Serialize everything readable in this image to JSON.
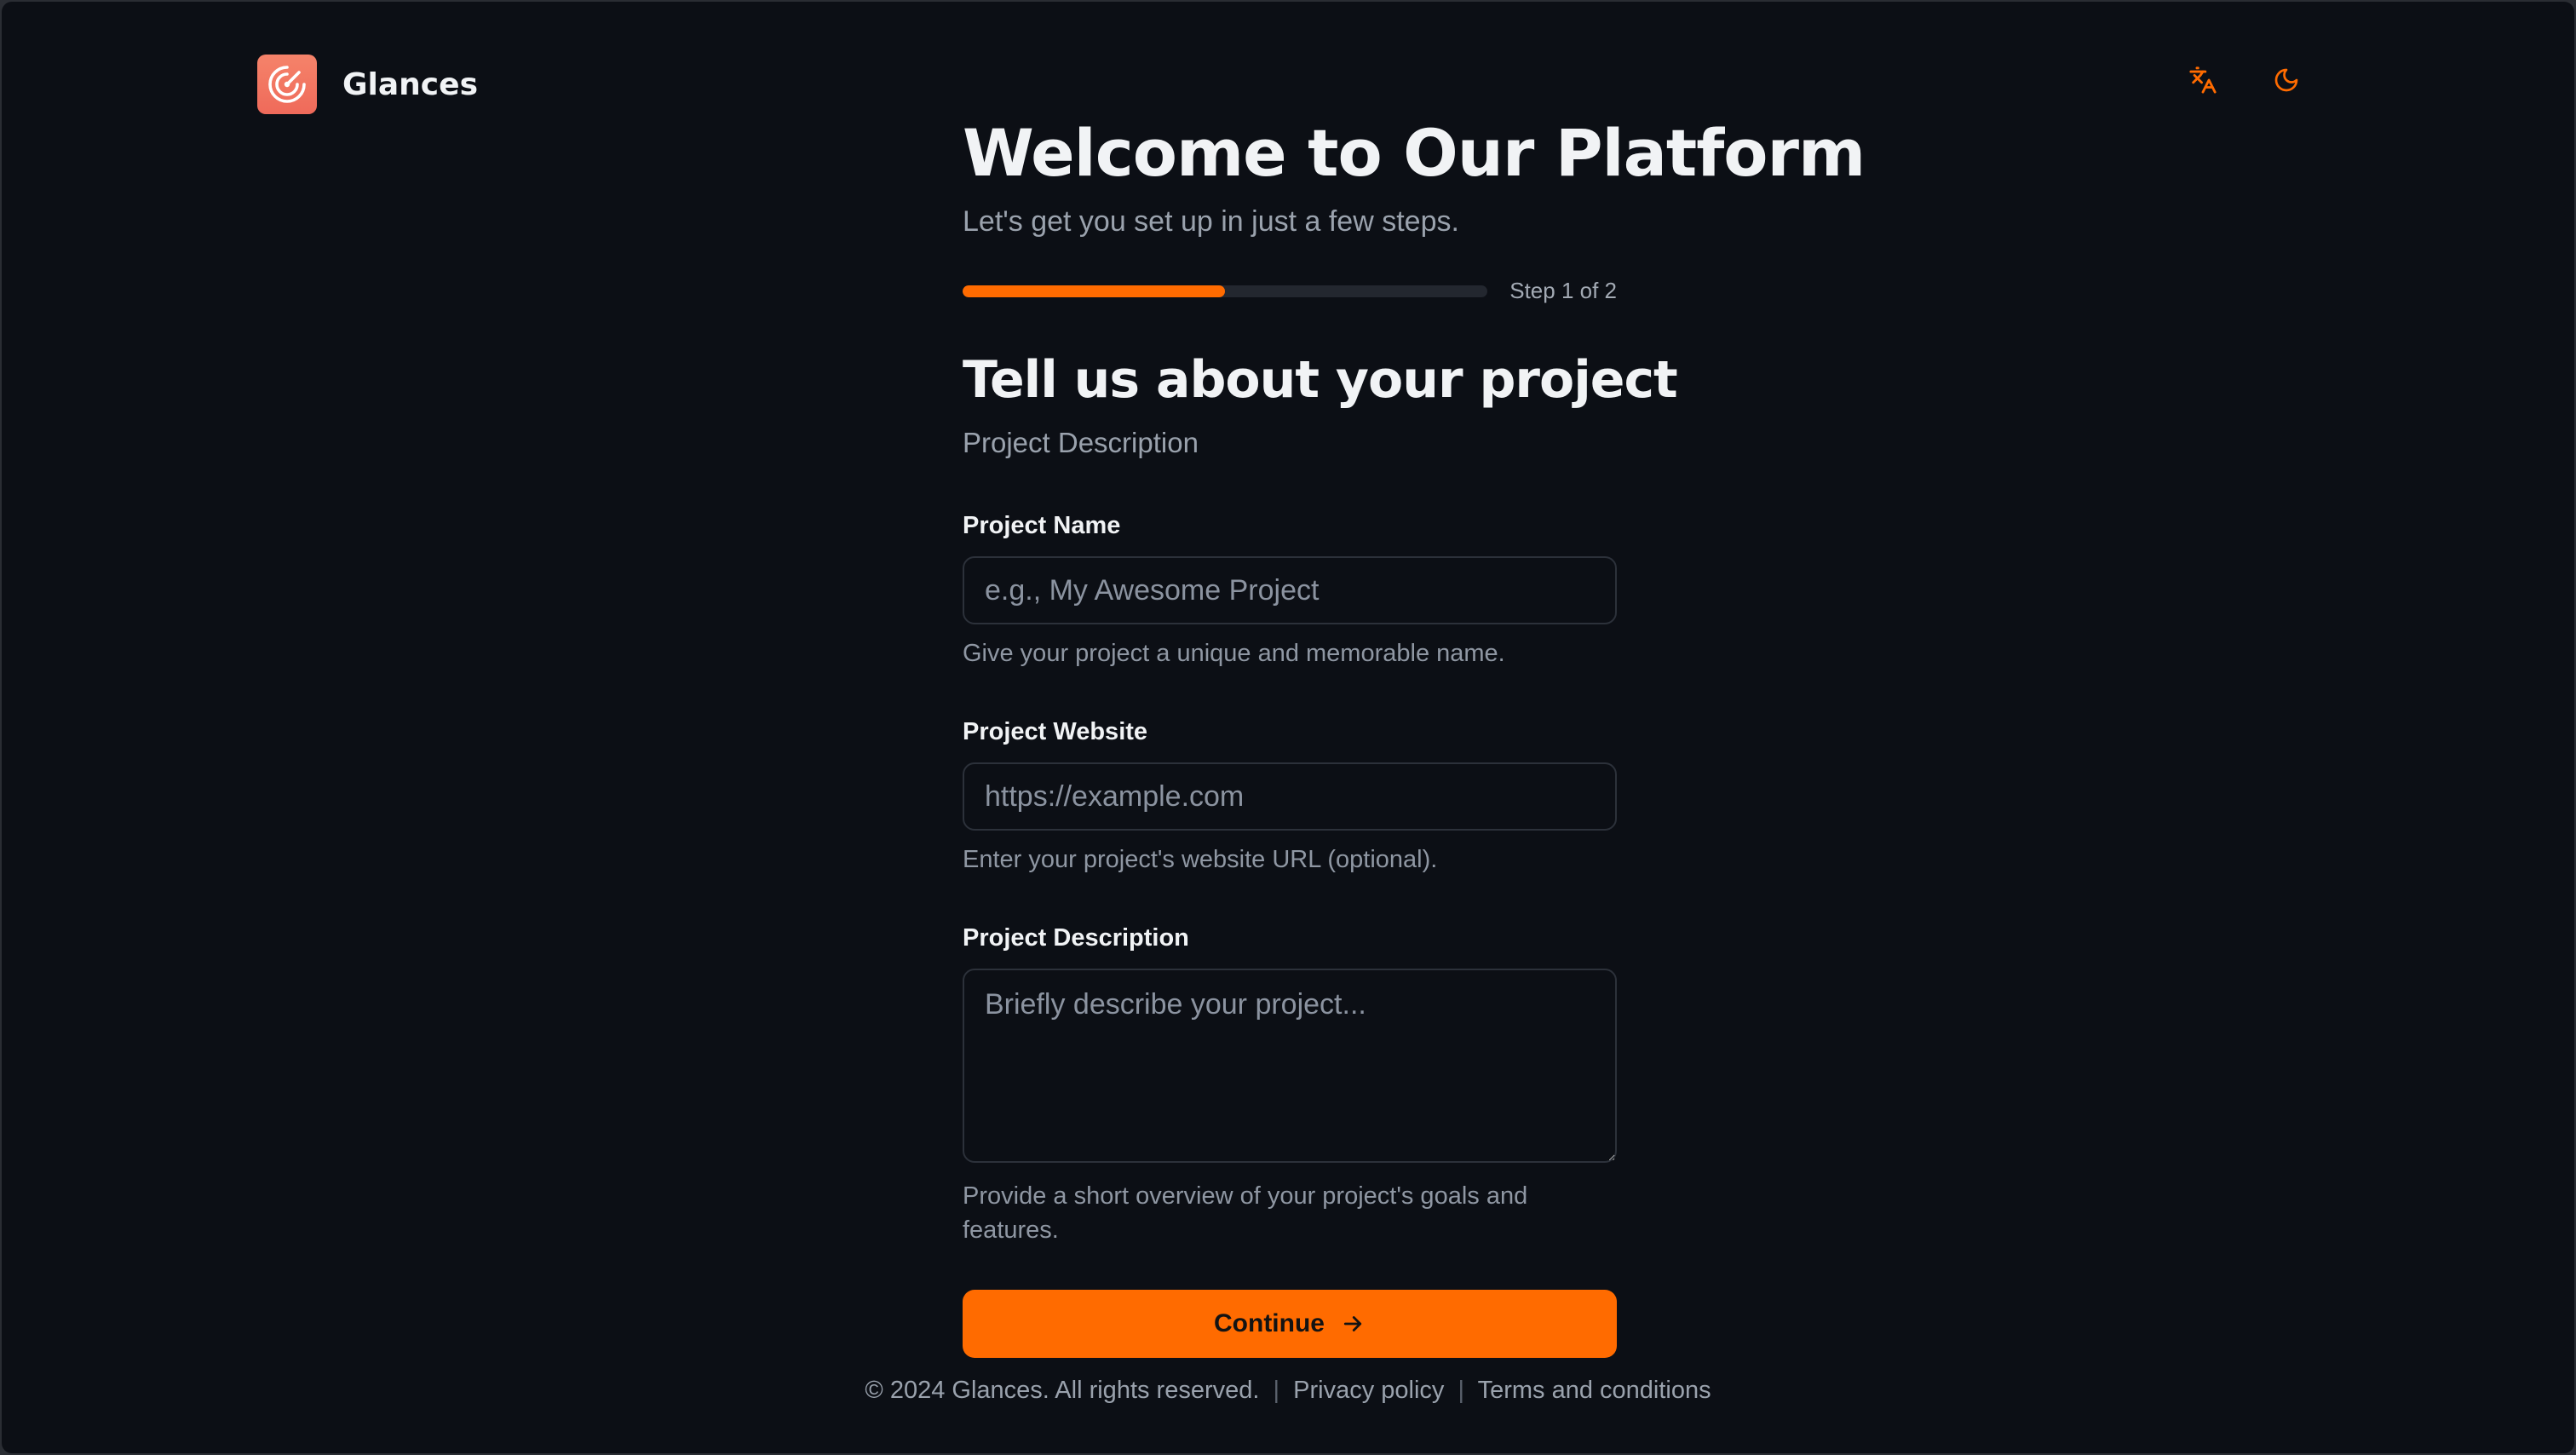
{
  "app": {
    "name": "Glances"
  },
  "header": {
    "actions": [
      {
        "icon": "translate-icon",
        "color": "#ff6b00"
      },
      {
        "icon": "moon-icon",
        "color": "#ff6b00"
      }
    ]
  },
  "welcome": {
    "title": "Welcome to Our Platform",
    "subtitle": "Let's get you set up in just a few steps."
  },
  "progress": {
    "label": "Step 1 of 2",
    "current_step": 1,
    "total_steps": 2,
    "fraction": 0.5
  },
  "step": {
    "title": "Tell us about your project",
    "subtitle": "Project Description"
  },
  "form": {
    "project_name": {
      "label": "Project Name",
      "placeholder": "e.g., My Awesome Project",
      "help": "Give your project a unique and memorable name."
    },
    "project_website": {
      "label": "Project Website",
      "placeholder": "https://example.com",
      "help": "Enter your project's website URL (optional)."
    },
    "project_description": {
      "label": "Project Description",
      "placeholder": "Briefly describe your project...",
      "help": "Provide a short overview of your project's goals and features."
    },
    "continue_label": "Continue"
  },
  "footer": {
    "copyright": "© 2024 Glances. All rights reserved.",
    "privacy": "Privacy policy",
    "terms": "Terms and conditions"
  },
  "colors": {
    "accent": "#ff6b00",
    "background": "#0c0f15",
    "logo": "#ef6a5a"
  }
}
